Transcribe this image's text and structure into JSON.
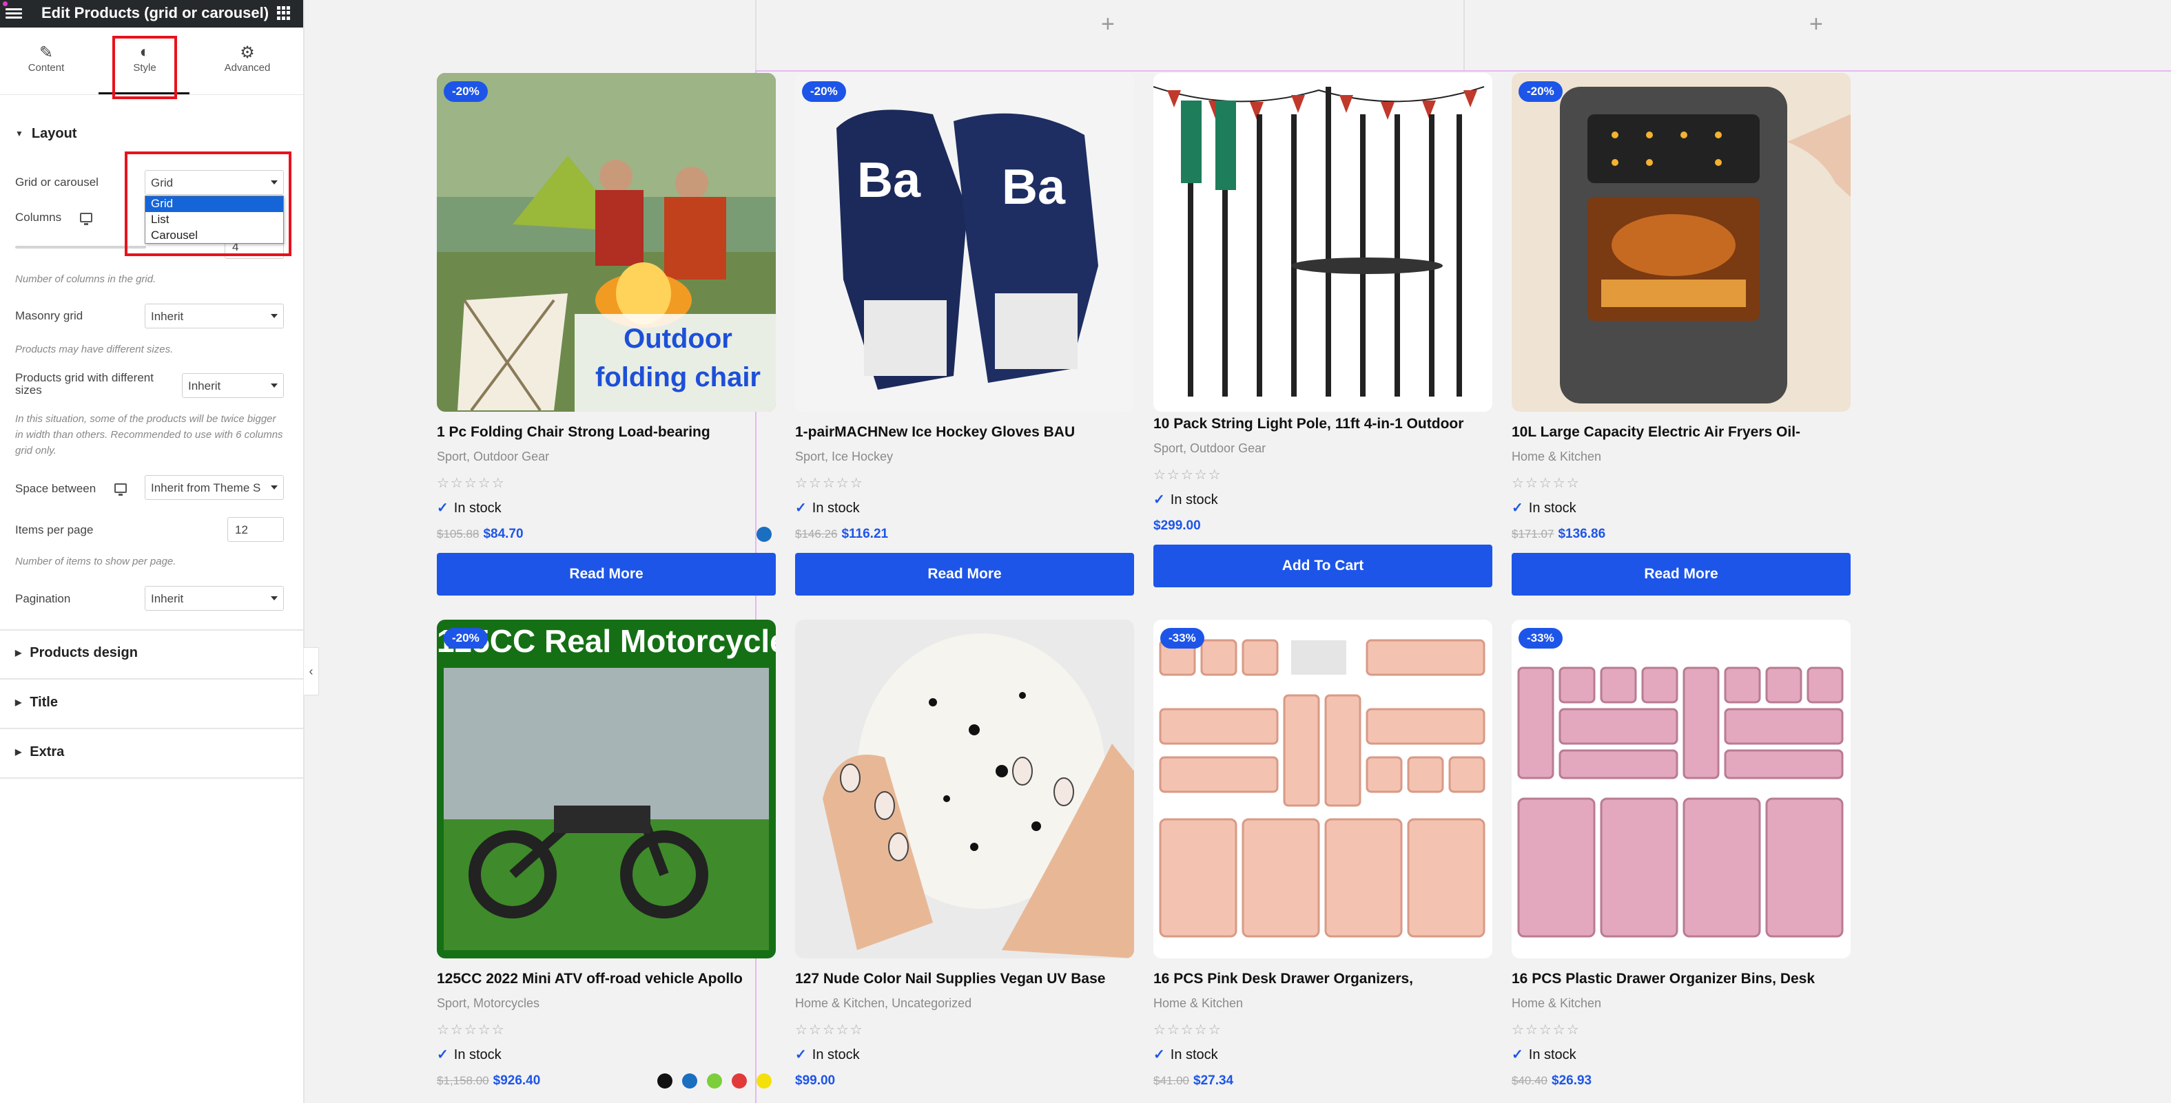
{
  "editor": {
    "title": "Edit Products (grid or carousel)",
    "tabs": [
      {
        "label": "Content",
        "icon": "pencil-icon"
      },
      {
        "label": "Style",
        "icon": "half-circle-icon"
      },
      {
        "label": "Advanced",
        "icon": "gear-icon"
      }
    ],
    "layout": {
      "heading": "Layout",
      "grid_or_carousel": {
        "label": "Grid or carousel",
        "value": "Grid",
        "options": [
          "Grid",
          "List",
          "Carousel"
        ]
      },
      "columns": {
        "label": "Columns",
        "value": "4",
        "help": "Number of columns in the grid."
      },
      "masonry": {
        "label": "Masonry grid",
        "value": "Inherit",
        "help": "Products may have different sizes."
      },
      "different_sizes": {
        "label": "Products grid with different sizes",
        "value": "Inherit",
        "help": "In this situation, some of the products will be twice bigger in width than others. Recommended to use with 6 columns grid only."
      },
      "space_between": {
        "label": "Space between",
        "value": "Inherit from Theme S"
      },
      "items_per_page": {
        "label": "Items per page",
        "value": "12",
        "help": "Number of items to show per page."
      },
      "pagination": {
        "label": "Pagination",
        "value": "Inherit"
      }
    },
    "sections": [
      "Products design",
      "Title",
      "Extra"
    ]
  },
  "colors": {
    "accent": "#1d55e8",
    "highlight": "#e8121c",
    "header_bg": "#26292c"
  },
  "products": [
    {
      "badge": "-20%",
      "name": "1 Pc Folding Chair Strong Load-bearing",
      "category": "Sport, Outdoor Gear",
      "stock": "In stock",
      "old_price": "$105.88",
      "price": "$84.70",
      "button": "Read More",
      "image_text": "Outdoor folding chair",
      "swatches": [
        "#1a6fc0"
      ]
    },
    {
      "badge": "-20%",
      "name": "1-pairMACHNew Ice Hockey Gloves BAU",
      "category": "Sport, Ice Hockey",
      "stock": "In stock",
      "old_price": "$146.26",
      "price": "$116.21",
      "button": "Read More",
      "image_text": "",
      "swatches": []
    },
    {
      "badge": "",
      "name": "10 Pack String Light Pole, 11ft 4-in-1 Outdoor",
      "category": "Sport, Outdoor Gear",
      "stock": "In stock",
      "old_price": "",
      "price": "$299.00",
      "button": "Add To Cart",
      "image_text": "",
      "swatches": []
    },
    {
      "badge": "-20%",
      "name": "10L Large Capacity Electric Air Fryers Oil-",
      "category": "Home & Kitchen",
      "stock": "In stock",
      "old_price": "$171.07",
      "price": "$136.86",
      "button": "Read More",
      "image_text": "",
      "swatches": []
    },
    {
      "badge": "-20%",
      "name": "125CC 2022 Mini ATV off-road vehicle Apollo",
      "category": "Sport, Motorcycles",
      "stock": "In stock",
      "old_price": "$1,158.00",
      "price": "$926.40",
      "button": "",
      "image_text": "125CC Real Motorcycle",
      "swatches": [
        "#111111",
        "#1a6fc0",
        "#7ccf3a",
        "#e23a3a",
        "#f4e10b"
      ]
    },
    {
      "badge": "",
      "name": "127 Nude Color Nail Supplies Vegan UV Base",
      "category": "Home & Kitchen, Uncategorized",
      "stock": "In stock",
      "old_price": "",
      "price": "$99.00",
      "button": "",
      "image_text": "",
      "swatches": []
    },
    {
      "badge": "-33%",
      "name": "16 PCS Pink Desk Drawer Organizers,",
      "category": "Home & Kitchen",
      "stock": "In stock",
      "old_price": "$41.00",
      "price": "$27.34",
      "button": "",
      "image_text": "",
      "swatches": []
    },
    {
      "badge": "-33%",
      "name": "16 PCS Plastic Drawer Organizer Bins, Desk",
      "category": "Home & Kitchen",
      "stock": "In stock",
      "old_price": "$40.40",
      "price": "$26.93",
      "button": "",
      "image_text": "",
      "swatches": []
    }
  ]
}
